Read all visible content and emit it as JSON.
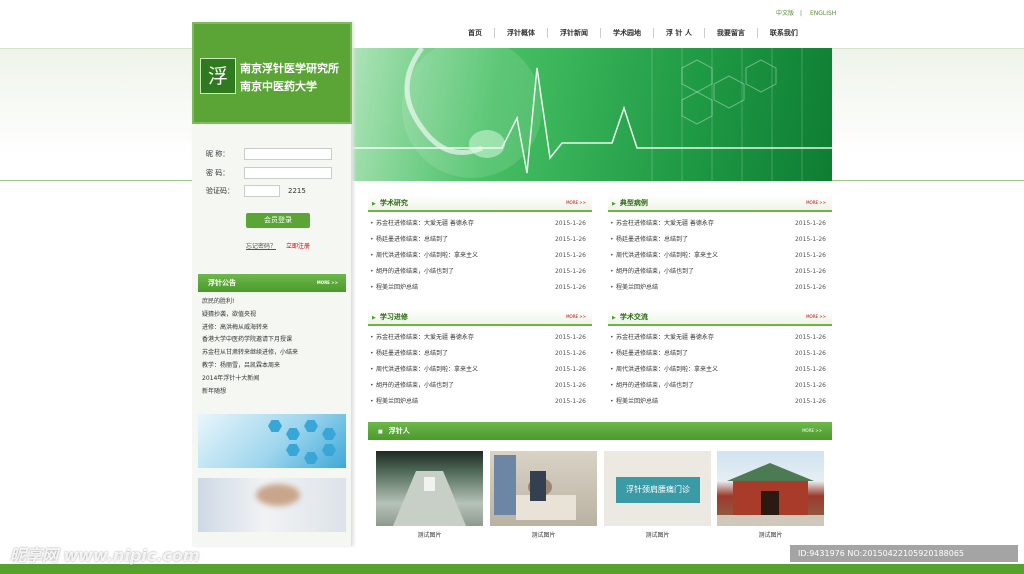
{
  "lang": {
    "zh": "中文版",
    "en": "ENGLISH"
  },
  "nav": [
    "首页",
    "浮针概体",
    "浮针新闻",
    "学术园地",
    "浮 针 人",
    "我要留言",
    "联系我们"
  ],
  "logo": {
    "line1": "南京浮针医学研究所",
    "line2": "南京中医药大学",
    "icon_text": "浮"
  },
  "login": {
    "nickname_label": "昵  称：",
    "password_label": "密  码：",
    "captcha_label": "验证码：",
    "captcha_value": "2215",
    "login_button": "会员登录",
    "forgot": "忘记密码？",
    "register": "立即注册"
  },
  "notice": {
    "title": "浮针公告",
    "more": "MORE >>",
    "items": [
      "庶民的胜利!",
      "疑猜抄袭，欲值央视",
      "进修：高洪梅从威海转来",
      "香港大学中医药学院邀请下月授课",
      "苏金柱从甘肃转来继续进修，小结来",
      "教学：杨丽雪，吕凯霖本周来",
      "2014年浮针十大新闻",
      "新年随想"
    ]
  },
  "boxes": [
    {
      "title": "学术研究",
      "more": "MORE >>",
      "rows": [
        {
          "text": "苏金柱进修结束：大爱无疆 善德永存",
          "date": "2015-1-26"
        },
        {
          "text": "杨廷墨进修结束：总结到了",
          "date": "2015-1-26"
        },
        {
          "text": "周代洪进修结束：小结到啦：拿来主义",
          "date": "2015-1-26"
        },
        {
          "text": "胡丹的进修结束，小结也到了",
          "date": "2015-1-26"
        },
        {
          "text": "程美兰回炉总结",
          "date": "2015-1-26"
        }
      ]
    },
    {
      "title": "典型病例",
      "more": "MORE >>",
      "rows": [
        {
          "text": "苏金柱进修结束：大爱无疆 善德永存",
          "date": "2015-1-26"
        },
        {
          "text": "杨廷墨进修结束：总结到了",
          "date": "2015-1-26"
        },
        {
          "text": "周代洪进修结束：小结到啦：拿来主义",
          "date": "2015-1-26"
        },
        {
          "text": "胡丹的进修结束，小结也到了",
          "date": "2015-1-26"
        },
        {
          "text": "程美兰回炉总结",
          "date": "2015-1-26"
        }
      ]
    },
    {
      "title": "学习进修",
      "more": "MORE >>",
      "rows": [
        {
          "text": "苏金柱进修结束：大爱无疆 善德永存",
          "date": "2015-1-26"
        },
        {
          "text": "杨廷墨进修结束：总结到了",
          "date": "2015-1-26"
        },
        {
          "text": "周代洪进修结束：小结到啦：拿来主义",
          "date": "2015-1-26"
        },
        {
          "text": "胡丹的进修结束，小结也到了",
          "date": "2015-1-26"
        },
        {
          "text": "程美兰回炉总结",
          "date": "2015-1-26"
        }
      ]
    },
    {
      "title": "学术交流",
      "more": "MORE >>",
      "rows": [
        {
          "text": "苏金柱进修结束：大爱无疆 善德永存",
          "date": "2015-1-26"
        },
        {
          "text": "杨廷墨进修结束：总结到了",
          "date": "2015-1-26"
        },
        {
          "text": "周代洪进修结束：小结到啦：拿来主义",
          "date": "2015-1-26"
        },
        {
          "text": "胡丹的进修结束，小结也到了",
          "date": "2015-1-26"
        },
        {
          "text": "程美兰回炉总结",
          "date": "2015-1-26"
        }
      ]
    }
  ],
  "fuzhenren": {
    "title": "浮针人",
    "more": "MORE >>",
    "captions": [
      "测试图片",
      "测试图片",
      "测试图片",
      "测试图片"
    ],
    "sign_text": "浮针颈肩腰痛门诊"
  },
  "watermark": {
    "left": "昵享网 www.nipic.com",
    "right": "ID:9431976 NO:20150422105920188065"
  }
}
